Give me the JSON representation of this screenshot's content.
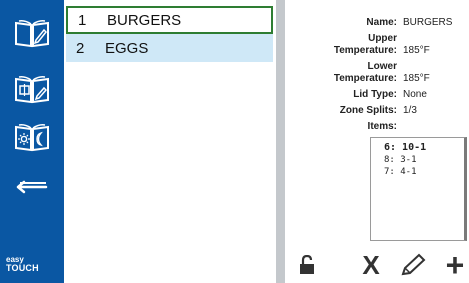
{
  "sidebar": {
    "buttons": [
      {
        "icon": "book-edit-icon"
      },
      {
        "icon": "book-tag-icon"
      },
      {
        "icon": "book-day-night-icon"
      },
      {
        "icon": "back-arrow-icon"
      }
    ],
    "logo_line1": "easy",
    "logo_line2": "TOUCH"
  },
  "menu": {
    "items": [
      {
        "number": "1",
        "name": "BURGERS",
        "selected": true
      },
      {
        "number": "2",
        "name": "EGGS",
        "selected": false
      }
    ]
  },
  "details": {
    "name_label": "Name:",
    "name_value": "BURGERS",
    "upper_label_1": "Upper",
    "upper_label_2": "Temperature:",
    "upper_value": "185°F",
    "lower_label_1": "Lower",
    "lower_label_2": "Temperature:",
    "lower_value": "185°F",
    "lid_label": "Lid Type:",
    "lid_value": "None",
    "zone_label": "Zone Splits:",
    "zone_value": "1/3",
    "items_label": "Items:",
    "items": [
      "6: 10-1",
      "8: 3-1",
      "7: 4-1"
    ]
  },
  "actions": {
    "unlock_icon": "unlock-icon",
    "delete_label": "X",
    "edit_icon": "pencil-icon",
    "add_label": "+"
  },
  "colors": {
    "rail": "#0a57a3",
    "selected_border": "#2e7d32",
    "alt_row": "#cfe8f7",
    "divider": "#c4c8cc"
  }
}
